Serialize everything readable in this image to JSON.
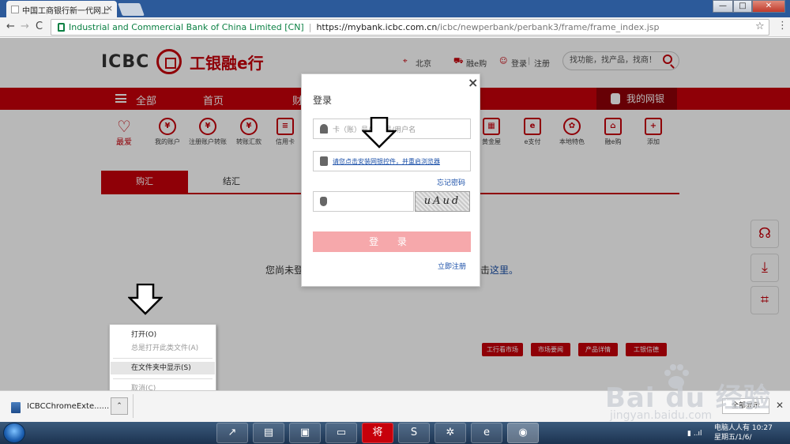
{
  "browser": {
    "tab_title": "中国工商银行新一代网上",
    "tab_close": "×",
    "win_min": "—",
    "win_max": "□",
    "win_close": "✕",
    "back": "←",
    "forward": "→",
    "reload": "C",
    "secure_label": "Industrial and Commercial Bank of China Limited [CN]",
    "url_sep": "|",
    "url_main": "https://mybank.icbc.com.cn",
    "url_path": "/icbc/newperbank/perbank3/frame/frame_index.jsp",
    "bookmark_star": "☆",
    "menu_kebab": "⋮"
  },
  "header": {
    "logo_text": "ICBC",
    "logo_cn": "工银融e行",
    "location_icon": "location-pin-icon",
    "location": "北京",
    "cart": "融e购",
    "login": "登录",
    "login_sep": "|",
    "register": "注册",
    "search_placeholder": "找功能，找产品，找商！"
  },
  "nav": {
    "all": "全部",
    "home": "首页",
    "finance": "财",
    "mybank": "我的网银"
  },
  "quick": [
    {
      "label": "我的账户",
      "icon": "¥"
    },
    {
      "label": "注册账户转账",
      "icon": "¥"
    },
    {
      "label": "转账汇款",
      "icon": "¥"
    },
    {
      "label": "信用卡",
      "icon": "≡"
    },
    {
      "label": "黄金屋",
      "icon": "▦"
    },
    {
      "label": "e支付",
      "icon": "e"
    },
    {
      "label": "本地特色",
      "icon": "✿"
    },
    {
      "label": "融e购",
      "icon": "⌂"
    },
    {
      "label": "添加",
      "icon": "+"
    }
  ],
  "favorites": "最爱",
  "subtabs": {
    "buy": "购汇",
    "settle": "结汇",
    "third": "..."
  },
  "notice": {
    "text": "您尚未登",
    "tail": "击",
    "link": "这里。"
  },
  "pills": [
    "工行看市场",
    "市场要闻",
    "产品详情",
    "工银信德"
  ],
  "side": {
    "service": "☊",
    "download": "⤓",
    "scan": "⌗"
  },
  "login_modal": {
    "close": "×",
    "title": "登录",
    "card_placeholder": "卡（账）号/手机号/用户名",
    "plugin_link": "请您点击安装网银控件，并重启浏览器",
    "forgot": "忘记密码",
    "captcha": "uAud",
    "login_button": "登 录",
    "register": "立即注册"
  },
  "context_menu": {
    "open": "打开(O)",
    "always_open": "总是打开此类文件(A)",
    "show_in_folder": "在文件夹中显示(S)",
    "cancel": "取消(C)"
  },
  "download": {
    "filename": "ICBCChromeExte......",
    "caret": "⌃",
    "show_all": "全部显示",
    "close": "✕"
  },
  "taskbar": {
    "apps": [
      "↗",
      "▤",
      "▣",
      "▭",
      "将",
      "S",
      "✲",
      "e",
      "◉"
    ],
    "tray_line1": "电脑人人有 10:27",
    "tray_line2": "星期五/1/6/",
    "tray_icon": "▮ ..ıl"
  },
  "watermark": {
    "text": "Bai du 经验",
    "sub": "jingyan.baidu.com"
  },
  "colors": {
    "brand_red": "#c7000b",
    "login_button": "#f6a8ab",
    "link_blue": "#1a4fa8",
    "secure_green": "#0b8043"
  }
}
